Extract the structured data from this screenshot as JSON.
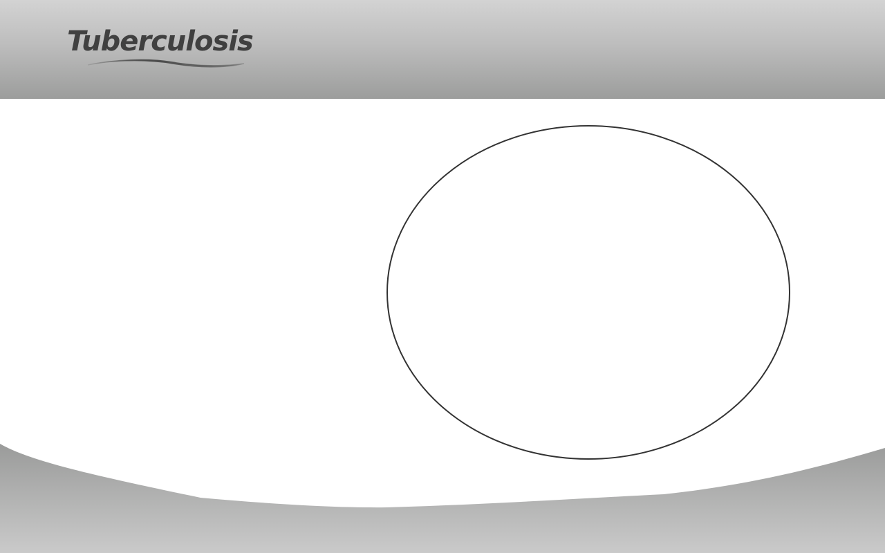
{
  "slide": {
    "title": "Tuberculosis"
  },
  "colors": {
    "header_top": "#d3d3d3",
    "header_bottom": "#9c9d9c",
    "footer_top": "#9a9b9a",
    "footer_bottom": "#cacaca",
    "title_text": "#404040",
    "ellipse_stroke": "#333333",
    "background": "#ffffff"
  },
  "decorations": {
    "header_band": "gray-gradient-band",
    "title_underline": "swoosh-icon",
    "centerpiece": "ellipse-outline",
    "footer": "gray-wave"
  }
}
